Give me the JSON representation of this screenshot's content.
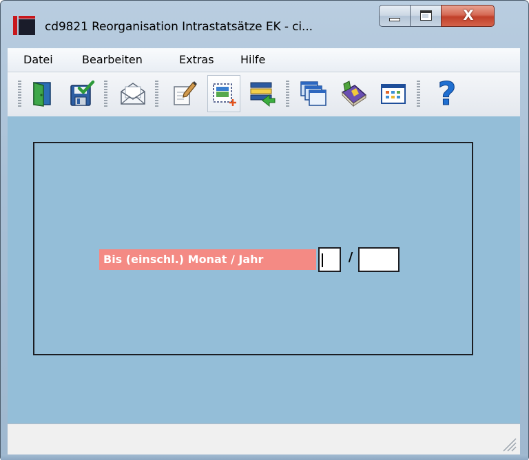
{
  "window": {
    "title": "cd9821 Reorganisation Intrastatsätze EK - ci...",
    "buttons": {
      "minimize": "minimize-icon",
      "maximize": "maximize-icon",
      "close": "close-icon",
      "close_glyph": "X"
    }
  },
  "menu": {
    "items": [
      {
        "label": "Datei"
      },
      {
        "label": "Bearbeiten"
      },
      {
        "label": "Extras"
      },
      {
        "label": "Hilfe"
      }
    ]
  },
  "toolbar": {
    "buttons": [
      {
        "icon": "exit-door-icon"
      },
      {
        "icon": "save-icon"
      },
      {
        "icon": "mail-envelope-icon"
      },
      {
        "icon": "edit-notepad-icon"
      },
      {
        "icon": "new-record-icon",
        "active": true
      },
      {
        "icon": "list-transfer-icon"
      },
      {
        "icon": "windows-stack-icon"
      },
      {
        "icon": "book-icon"
      },
      {
        "icon": "calendar-grid-icon"
      },
      {
        "icon": "help-question-icon",
        "glyph": "?"
      }
    ]
  },
  "form": {
    "label": "Bis (einschl.) Monat / Jahr",
    "separator": "/",
    "month_value": "",
    "year_value": ""
  },
  "colors": {
    "client_background": "#94bed8",
    "label_background": "#f48a84",
    "label_text": "#ffffff"
  }
}
